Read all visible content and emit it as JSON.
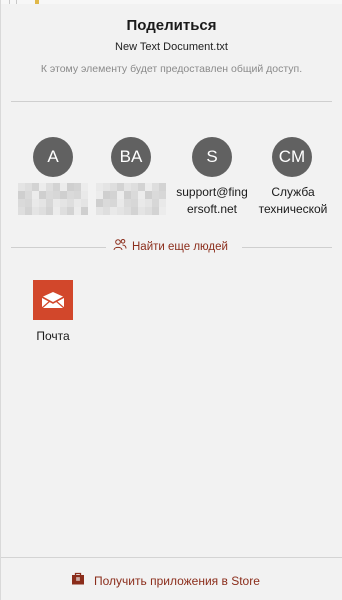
{
  "panel": {
    "title": "Поделиться",
    "filename": "New Text Document.txt",
    "subtitle": "К этому элементу будет предоставлен общий доступ."
  },
  "contacts": [
    {
      "initials": "A",
      "label": "",
      "redacted": true
    },
    {
      "initials": "BA",
      "label": "",
      "redacted": true
    },
    {
      "initials": "S",
      "label": "support@fingersoft.net",
      "redacted": false
    },
    {
      "initials": "CM",
      "label": "Служба технической",
      "redacted": false
    }
  ],
  "find_people": {
    "label": "Найти еще людей",
    "icon": "people-icon"
  },
  "apps": [
    {
      "label": "Почта",
      "icon": "mail-icon",
      "color": "#d2472b"
    }
  ],
  "store": {
    "label": "Получить приложения в Store",
    "icon": "store-icon"
  },
  "colors": {
    "accent_link": "#8b2d1b",
    "avatar": "#616161",
    "mail_tile": "#d2472b"
  }
}
